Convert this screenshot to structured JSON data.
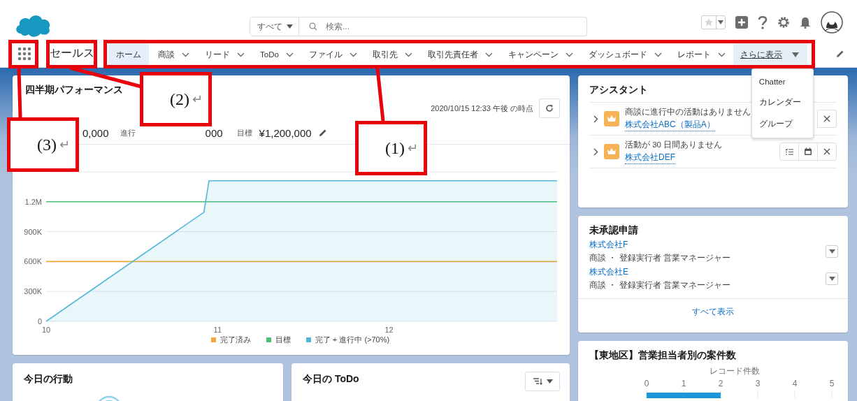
{
  "header": {
    "search": {
      "scope": "すべて",
      "placeholder": "検索..."
    }
  },
  "nav": {
    "app_name": "セールス",
    "tabs": [
      {
        "label": "ホーム",
        "selected": true,
        "has_menu": false
      },
      {
        "label": "商談",
        "selected": false,
        "has_menu": true
      },
      {
        "label": "リード",
        "selected": false,
        "has_menu": true
      },
      {
        "label": "ToDo",
        "selected": false,
        "has_menu": true
      },
      {
        "label": "ファイル",
        "selected": false,
        "has_menu": true
      },
      {
        "label": "取引先",
        "selected": false,
        "has_menu": true
      },
      {
        "label": "取引先責任者",
        "selected": false,
        "has_menu": true
      },
      {
        "label": "キャンペーン",
        "selected": false,
        "has_menu": true
      },
      {
        "label": "ダッシュボード",
        "selected": false,
        "has_menu": true
      },
      {
        "label": "レポート",
        "selected": false,
        "has_menu": true
      }
    ],
    "more": {
      "label": "さらに表示",
      "expanded": true,
      "items": [
        "Chatter",
        "カレンダー",
        "グループ"
      ]
    }
  },
  "performance": {
    "title": "四半期パフォーマンス",
    "as_of": "2020/10/15 12:33 午後 の時点",
    "metrics": [
      {
        "value": "0,000"
      },
      {
        "label": "進行"
      },
      {
        "value": "000"
      },
      {
        "label": "目標",
        "value": "¥1,200,000"
      }
    ],
    "chart_data": {
      "type": "line",
      "x": [
        10,
        10.92,
        10.95,
        12.98
      ],
      "xlim": [
        10,
        12.98
      ],
      "ylim": [
        0,
        1500000
      ],
      "xticks": [
        10,
        11,
        12
      ],
      "yticks": [
        0,
        {
          "value": 300000,
          "label": "300K"
        },
        {
          "value": 600000,
          "label": "600K"
        },
        {
          "value": 900000,
          "label": "900K"
        },
        {
          "value": 1200000,
          "label": "1.2M"
        }
      ],
      "legend": "bottom",
      "series": [
        {
          "name": "完了済み",
          "color": "#f4a73b",
          "type": "line",
          "values": [
            600000,
            600000,
            600000,
            600000
          ]
        },
        {
          "name": "目標",
          "color": "#4bc076",
          "type": "line",
          "values": [
            1200000,
            1200000,
            1200000,
            1200000
          ]
        },
        {
          "name": "完了 + 進行中 (>70%)",
          "color": "#52b7d8",
          "type": "area",
          "values": [
            0,
            1095000,
            1410000,
            1410000
          ]
        }
      ]
    }
  },
  "assistant": {
    "title": "アシスタント",
    "items": [
      {
        "message": "商談に進行中の活動はありません",
        "link": "株式会社ABC（製品A）",
        "actions": [
          {
            "kind": "close"
          }
        ]
      },
      {
        "message": "活動が 30 日間ありません",
        "link": "株式会社DEF",
        "actions": [
          {
            "kind": "task"
          },
          {
            "kind": "event"
          },
          {
            "kind": "close"
          }
        ]
      }
    ]
  },
  "approvals": {
    "title": "未承認申請",
    "items": [
      {
        "name": "株式会社F",
        "detail": "商談 ・ 登録実行者 営業マネージャー"
      },
      {
        "name": "株式会社E",
        "detail": "商談 ・ 登録実行者 営業マネージャー"
      }
    ],
    "view_all": "すべて表示"
  },
  "east": {
    "title": "【東地区】営業担当者別の案件数",
    "axis_title": "レコード件数",
    "ticks": [
      "0",
      "1",
      "2",
      "3",
      "4",
      "5"
    ],
    "bars": [
      {
        "level": 0.4
      }
    ]
  },
  "events": {
    "title": "今日の行動"
  },
  "todo": {
    "title": "今日の ToDo"
  },
  "annotations": [
    {
      "number": "(1)",
      "mark": "↵"
    },
    {
      "number": "(2)",
      "mark": "↵"
    },
    {
      "number": "(3)",
      "mark": "↵"
    }
  ]
}
